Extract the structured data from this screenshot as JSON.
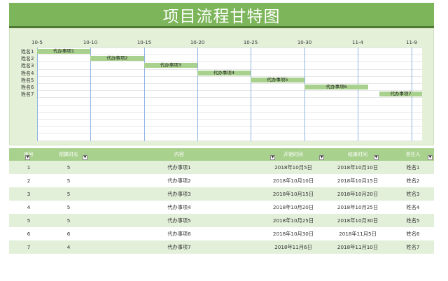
{
  "title": "项目流程甘特图",
  "colors": {
    "title_bg": "#7cb55a",
    "bar": "#a9d18e",
    "panel": "#e4f0d8",
    "header": "#a9d18e",
    "row_alt": "#e2efd9",
    "grid_v": "#8eb4e3"
  },
  "gantt": {
    "date_ticks": [
      "10-5",
      "10-10",
      "10-15",
      "10-20",
      "10-25",
      "10-30",
      "11-4",
      "11-9"
    ],
    "rows": [
      {
        "name": "姓名1",
        "task": "代办事项1",
        "start": "10-5",
        "end": "10-10"
      },
      {
        "name": "姓名2",
        "task": "代办事项2",
        "start": "10-10",
        "end": "10-15"
      },
      {
        "name": "姓名3",
        "task": "代办事项3",
        "start": "10-15",
        "end": "10-20"
      },
      {
        "name": "姓名4",
        "task": "代办事项4",
        "start": "10-20",
        "end": "10-25"
      },
      {
        "name": "姓名5",
        "task": "代办事项5",
        "start": "10-25",
        "end": "10-30"
      },
      {
        "name": "姓名6",
        "task": "代办事项6",
        "start": "10-30",
        "end": "11-5"
      },
      {
        "name": "姓名7",
        "task": "代办事项7",
        "start": "11-6",
        "end": "11-10"
      }
    ]
  },
  "table": {
    "headers": [
      "序号",
      "预算时长",
      "内容",
      "开始时间",
      "结束时间",
      "责任人"
    ],
    "rows": [
      [
        "1",
        "5",
        "代办事项1",
        "2018年10月5日",
        "2018年10月10日",
        "姓名1"
      ],
      [
        "2",
        "5",
        "代办事项2",
        "2018年10月10日",
        "2018年10月15日",
        "姓名2"
      ],
      [
        "3",
        "5",
        "代办事项3",
        "2018年10月15日",
        "2018年10月20日",
        "姓名3"
      ],
      [
        "4",
        "5",
        "代办事项4",
        "2018年10月20日",
        "2018年10月25日",
        "姓名4"
      ],
      [
        "5",
        "5",
        "代办事项5",
        "2018年10月25日",
        "2018年10月30日",
        "姓名5"
      ],
      [
        "6",
        "6",
        "代办事项6",
        "2018年10月30日",
        "2018年11月5日",
        "姓名6"
      ],
      [
        "7",
        "4",
        "代办事项7",
        "2018年11月6日",
        "2018年11月10日",
        "姓名7"
      ]
    ]
  }
}
